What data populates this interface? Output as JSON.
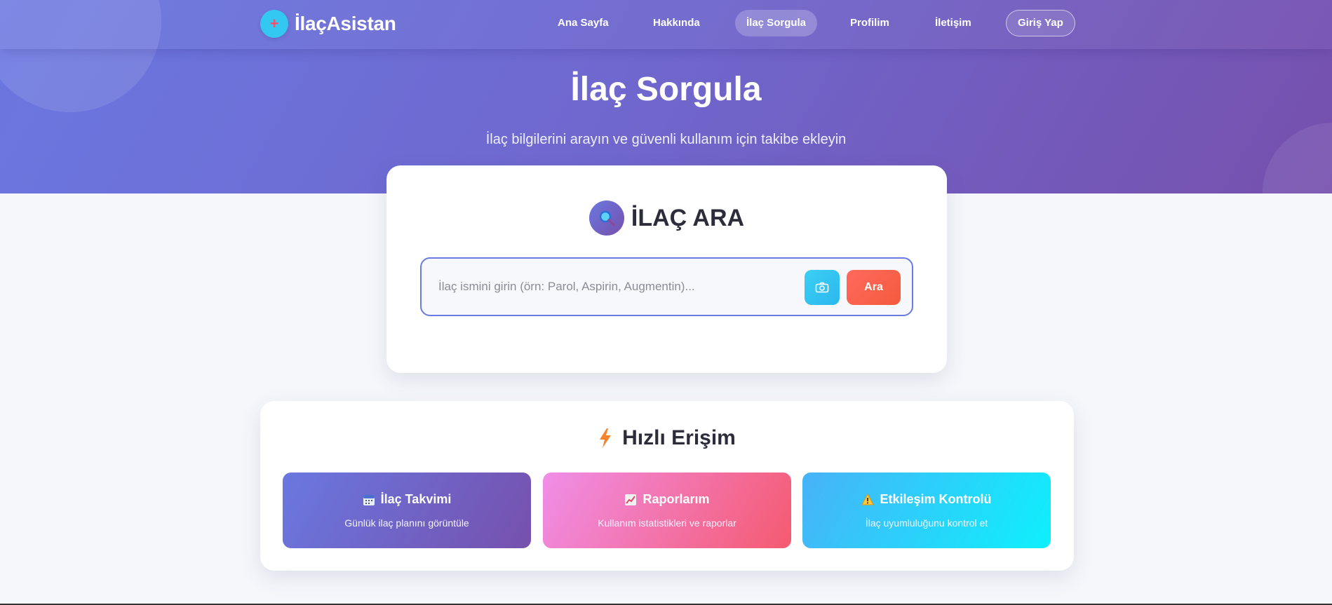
{
  "brand": {
    "logo_symbol": "+",
    "name": "İlaçAsistan"
  },
  "nav": {
    "items": [
      {
        "label": "Ana Sayfa"
      },
      {
        "label": "Hakkında"
      },
      {
        "label": "İlaç Sorgula"
      },
      {
        "label": "Profilim"
      },
      {
        "label": "İletişim"
      },
      {
        "label": "Giriş Yap"
      }
    ]
  },
  "hero": {
    "title": "İlaç Sorgula",
    "subtitle": "İlaç bilgilerini arayın ve güvenli kullanım için takibe ekleyin"
  },
  "search": {
    "heading": "İLAÇ ARA",
    "placeholder": "İlaç ismini girin (örn: Parol, Aspirin, Augmentin)...",
    "value": "",
    "button_label": "Ara",
    "camera_icon": "camera-icon",
    "heading_icon": "magnifier-icon"
  },
  "quick": {
    "heading": "Hızlı Erişim",
    "heading_icon": "lightning-icon",
    "tiles": [
      {
        "icon": "calendar-icon",
        "title": "İlaç Takvimi",
        "desc": "Günlük ilaç planını görüntüle"
      },
      {
        "icon": "chart-icon",
        "title": "Raporlarım",
        "desc": "Kullanım istatistikleri ve raporlar"
      },
      {
        "icon": "warning-icon",
        "title": "Etkileşim Kontrolü",
        "desc": "İlaç uyumluluğunu kontrol et"
      }
    ]
  },
  "colors": {
    "hero_start": "#6a78e0",
    "hero_end": "#7650ad",
    "search_button": "#f45a3c",
    "camera_button": "#2bb8ee",
    "input_border": "#6b7be6"
  }
}
